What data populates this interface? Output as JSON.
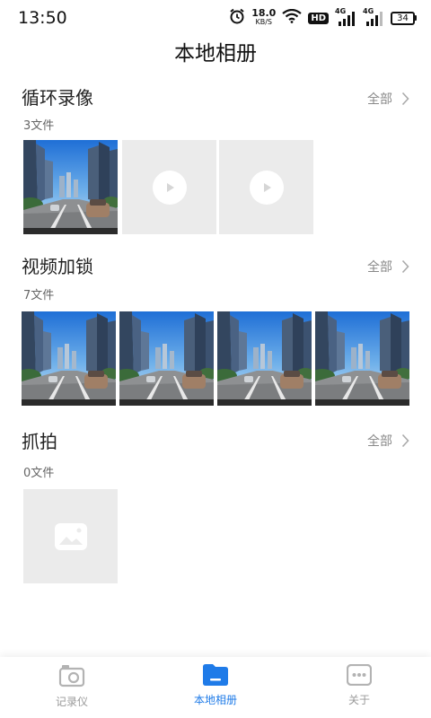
{
  "status_bar": {
    "time": "13:50",
    "net_speed": "18.0",
    "net_speed_unit": "KB/S",
    "hd_label": "HD",
    "network_type_1": "4G",
    "network_type_2": "4G",
    "battery": "34",
    "icons": [
      "alarm-icon",
      "wifi-icon",
      "hd-icon",
      "signal-icon",
      "battery-icon"
    ]
  },
  "header": {
    "title": "本地相册"
  },
  "sections": [
    {
      "title": "循环录像",
      "count": "3文件",
      "see_all": "全部",
      "items": [
        {
          "type": "photo",
          "icon": "street-photo"
        },
        {
          "type": "video-placeholder",
          "icon": "play-icon"
        },
        {
          "type": "video-placeholder",
          "icon": "play-icon"
        }
      ]
    },
    {
      "title": "视频加锁",
      "count": "7文件",
      "see_all": "全部",
      "items": [
        {
          "type": "photo",
          "icon": "street-photo"
        },
        {
          "type": "photo",
          "icon": "street-photo"
        },
        {
          "type": "photo",
          "icon": "street-photo"
        },
        {
          "type": "photo",
          "icon": "street-photo"
        }
      ]
    },
    {
      "title": "抓拍",
      "count": "0文件",
      "see_all": "全部",
      "items": [
        {
          "type": "image-placeholder",
          "icon": "image-icon"
        }
      ]
    }
  ],
  "tab_bar": {
    "tabs": [
      {
        "label": "记录仪",
        "icon": "camera-icon",
        "active": false
      },
      {
        "label": "本地相册",
        "icon": "folder-icon",
        "active": true
      },
      {
        "label": "关于",
        "icon": "chat-icon",
        "active": false
      }
    ]
  },
  "colors": {
    "accent": "#1f7be8",
    "inactive": "#999999",
    "placeholder": "#ebebeb"
  }
}
